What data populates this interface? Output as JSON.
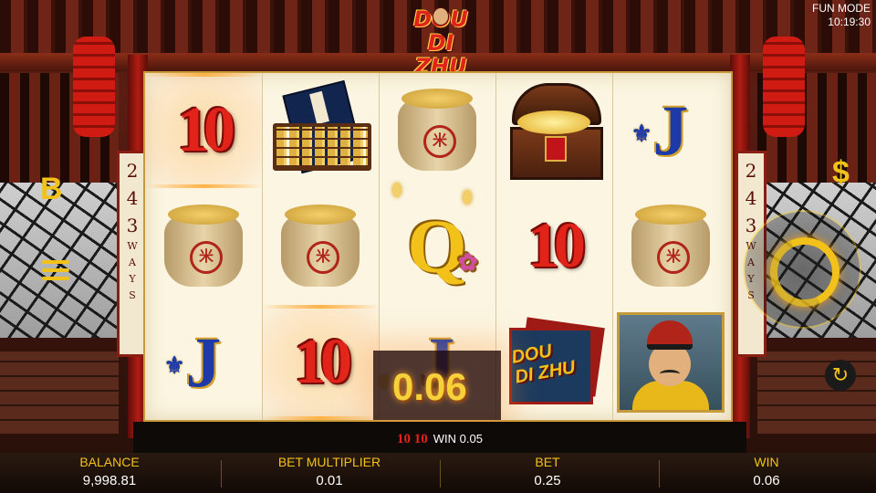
{
  "status": {
    "mode": "FUN MODE",
    "time": "10:19:30"
  },
  "logo": {
    "line1": "DOU",
    "line2": "DI ZHU"
  },
  "ways": {
    "number": [
      "2",
      "4",
      "3"
    ],
    "word": [
      "W",
      "A",
      "Y",
      "S"
    ]
  },
  "reels": [
    [
      "10",
      "sack",
      "J"
    ],
    [
      "book-abacus",
      "sack",
      "10"
    ],
    [
      "sack",
      "Q",
      "J"
    ],
    [
      "treasure-chest",
      "10",
      "dou-di-zhu-logo"
    ],
    [
      "J",
      "sack",
      "landlord-portrait"
    ]
  ],
  "symbol_text": {
    "ten": "10",
    "j": "J",
    "q": "Q",
    "seal": "米",
    "mini_logo1": "DOU",
    "mini_logo2": "DI ZHU"
  },
  "win_amount": "0.06",
  "line_message": {
    "symbols": "10 10",
    "text": "WIN 0.05"
  },
  "side_buttons": {
    "left_b": "B",
    "dollar": "$",
    "auto": "↻"
  },
  "bottom_bar": {
    "balance_label": "BALANCE",
    "balance": "9,998.81",
    "multiplier_label": "BET MULTIPLIER",
    "multiplier": "0.01",
    "bet_label": "BET",
    "bet": "0.25",
    "win_label": "WIN",
    "win": "0.06"
  },
  "colors": {
    "accent": "#f2c21a",
    "red": "#e2231a",
    "blue": "#1e3aa8"
  }
}
